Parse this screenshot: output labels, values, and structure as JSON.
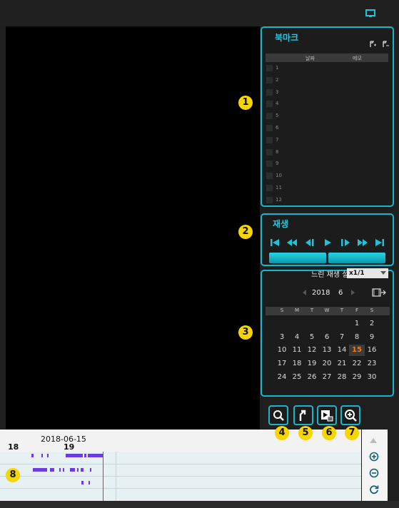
{
  "bookmark": {
    "title": "북마크",
    "col_date": "날짜",
    "col_memo": "메모",
    "rows": [
      "1",
      "2",
      "3",
      "4",
      "5",
      "6",
      "7",
      "8",
      "9",
      "10",
      "11",
      "12"
    ]
  },
  "playback": {
    "title": "재생"
  },
  "calendar": {
    "slow_label": "느린 재생 설정",
    "slow_value": "x1/1",
    "year": "2018",
    "month": "6",
    "weekdays": [
      "S",
      "M",
      "T",
      "W",
      "T",
      "F",
      "S"
    ],
    "weeks": [
      [
        "",
        "",
        "",
        "",
        "",
        "1",
        "2"
      ],
      [
        "3",
        "4",
        "5",
        "6",
        "7",
        "8",
        "9"
      ],
      [
        "10",
        "11",
        "12",
        "13",
        "14",
        "15",
        "16"
      ],
      [
        "17",
        "18",
        "19",
        "20",
        "21",
        "22",
        "23"
      ],
      [
        "24",
        "25",
        "26",
        "27",
        "28",
        "29",
        "30"
      ]
    ],
    "selected": "15"
  },
  "timeline": {
    "date": "2018-06-15",
    "tick_left": "18",
    "tick_right": "19"
  },
  "badges": [
    "1",
    "2",
    "3",
    "4",
    "5",
    "6",
    "7",
    "8"
  ],
  "colors": {
    "accent": "#1ab6c8",
    "badge": "#f6d500",
    "segment": "#6b3ce0",
    "selected_day": "#f07a1c"
  }
}
